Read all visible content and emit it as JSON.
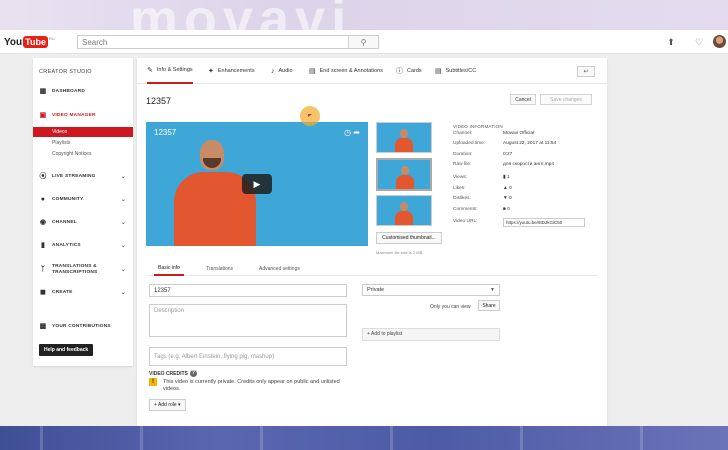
{
  "header": {
    "logo_you": "You",
    "logo_tube": "Tube",
    "logo_cc": "RU",
    "search_placeholder": "Search"
  },
  "sidebar": {
    "title": "CREATOR STUDIO",
    "dashboard": "DASHBOARD",
    "video_manager": "VIDEO MANAGER",
    "sub_items": [
      "Videos",
      "Playlists",
      "Copyright Notices"
    ],
    "live_streaming": "LIVE STREAMING",
    "community": "COMMUNITY",
    "channel": "CHANNEL",
    "analytics": "ANALYTICS",
    "translations_1": "TRANSLATIONS &",
    "translations_2": "TRANSCRIPTIONS",
    "create": "CREATE",
    "contributions": "YOUR CONTRIBUTIONS",
    "help": "Help and feedback"
  },
  "tabs": [
    "Info & Settings",
    "Enhancements",
    "Audio",
    "End screen & Annotations",
    "Cards",
    "Subtitles/CC"
  ],
  "video": {
    "title": "12357",
    "cancel": "Cancel",
    "save": "Save changes",
    "player_title": "12357",
    "custom_thumb": "Customised thumbnail...",
    "max_size": "Maximum file size is 2 MB."
  },
  "video_info": {
    "heading": "VIDEO INFORMATION",
    "rows": [
      {
        "label": "Channel:",
        "value": "Movavi Official"
      },
      {
        "label": "Uploaded time:",
        "value": "August 22, 2017 at 11:54"
      },
      {
        "label": "Duration:",
        "value": "0:27"
      },
      {
        "label": "Raw file:",
        "value": "для скорости англ.mp4"
      },
      {
        "label": "Views:",
        "value": "1"
      },
      {
        "label": "Likes:",
        "value": "0"
      },
      {
        "label": "Dislikes:",
        "value": "0"
      },
      {
        "label": "Comments:",
        "value": "0"
      }
    ],
    "url_label": "Video URL:",
    "url_value": "https://youtu.be/6tDJkGiC50"
  },
  "form": {
    "tabs": [
      "Basic info",
      "Translations",
      "Advanced settings"
    ],
    "title_value": "12357",
    "description_placeholder": "Description",
    "tags_placeholder": "Tags (e.g. Albert Einstein, flying pig, mashup)",
    "privacy": "Private",
    "only_you": "Only you can view",
    "share": "Share",
    "add_playlist": "+ Add to playlist",
    "credits_heading": "VIDEO CREDITS",
    "credits_warning": "This video is currently private. Credits only appear on public and unlisted videos.",
    "add_role": "+  Add role  ▾"
  },
  "colors": {
    "accent": "#cc181e",
    "youtube_red": "#e62117",
    "sky": "#3fa7d8",
    "shirt": "#e2572f"
  }
}
